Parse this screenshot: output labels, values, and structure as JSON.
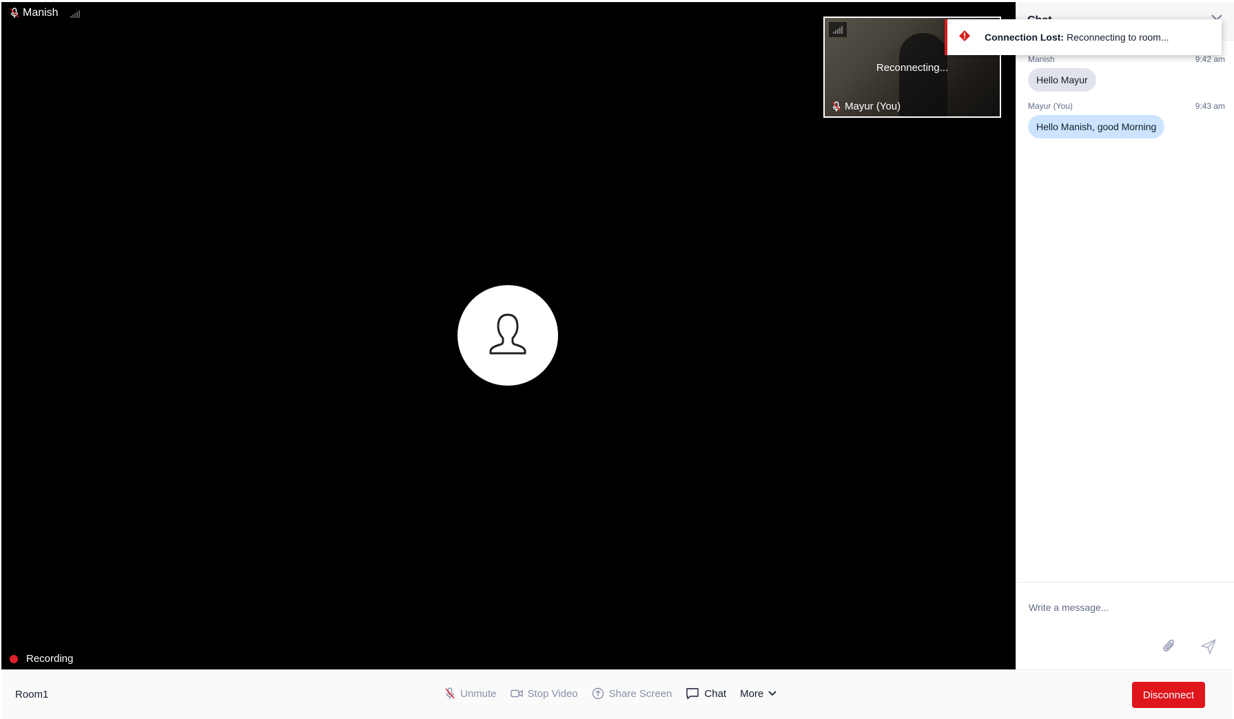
{
  "stage": {
    "participant_name": "Manish",
    "recording_label": "Recording"
  },
  "self_view": {
    "status": "Reconnecting...",
    "name": "Mayur (You)"
  },
  "toast": {
    "title": "Connection Lost:",
    "message": "Reconnecting to room..."
  },
  "chat": {
    "title": "Chat",
    "messages": [
      {
        "author": "Manish",
        "time": "9:42 am",
        "text": "Hello Mayur"
      },
      {
        "author": "Mayur (You)",
        "time": "9:43 am",
        "text": "Hello Manish, good Morning"
      }
    ],
    "input_placeholder": "Write a message..."
  },
  "toolbar": {
    "room_name": "Room1",
    "unmute_label": "Unmute",
    "stop_video_label": "Stop Video",
    "share_screen_label": "Share Screen",
    "chat_label": "Chat",
    "more_label": "More",
    "disconnect_label": "Disconnect"
  },
  "colors": {
    "disconnect": "#e0161d",
    "error": "#d61f1f",
    "bubble_other": "#e1e3ea",
    "bubble_self": "#cce4ff"
  }
}
